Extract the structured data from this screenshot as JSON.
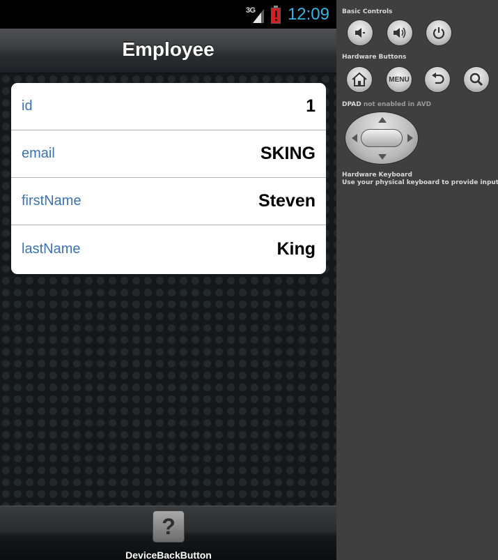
{
  "status_bar": {
    "network": "3G",
    "time": "12:09"
  },
  "header": {
    "title": "Employee"
  },
  "employee": {
    "fields": [
      {
        "label": "id",
        "value": "1"
      },
      {
        "label": "email",
        "value": "SKING"
      },
      {
        "label": "firstName",
        "value": "Steven"
      },
      {
        "label": "lastName",
        "value": "King"
      }
    ]
  },
  "footer": {
    "back_button_label": "DeviceBackButton",
    "back_button_icon": "?"
  },
  "controls": {
    "basic_controls_label": "Basic Controls",
    "hardware_buttons_label": "Hardware Buttons",
    "menu_label": "MENU",
    "dpad_label": "DPAD",
    "dpad_note": "not enabled in AVD",
    "keyboard_title": "Hardware Keyboard",
    "keyboard_note": "Use your physical keyboard to provide input"
  },
  "colors": {
    "clock": "#33b5e5",
    "field_label": "#3a72b2",
    "battery_alert": "#d32020"
  },
  "icons": {
    "basic": [
      "volume-down-icon",
      "volume-up-icon",
      "power-icon"
    ],
    "hardware": [
      "home-icon",
      "menu-icon",
      "back-icon",
      "search-icon"
    ]
  }
}
